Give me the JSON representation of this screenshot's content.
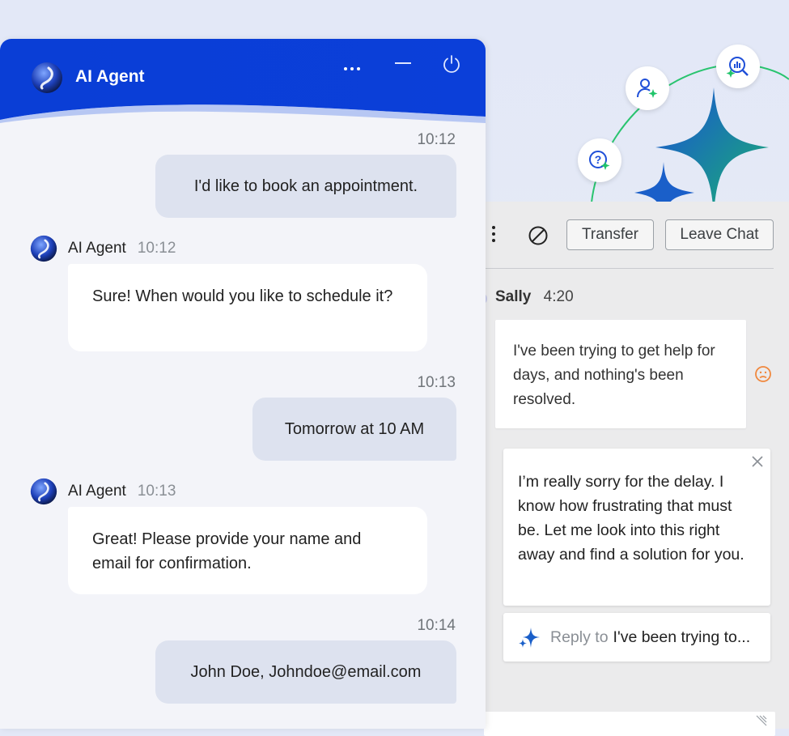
{
  "widget": {
    "title": "AI Agent",
    "messages": [
      {
        "type": "user",
        "time": "10:12",
        "text": "I'd like to book an appointment."
      },
      {
        "type": "agent",
        "name": "AI Agent",
        "time": "10:12",
        "text": "Sure! When would you like to schedule it?"
      },
      {
        "type": "user",
        "time": "10:13",
        "text": "Tomorrow at 10 AM"
      },
      {
        "type": "agent",
        "name": "AI Agent",
        "time": "10:13",
        "text": "Great! Please provide your name and email for confirmation."
      },
      {
        "type": "user",
        "time": "10:14",
        "text": "John Doe, Johndoe@email.com"
      }
    ]
  },
  "console": {
    "transfer_label": "Transfer",
    "leave_label": "Leave Chat",
    "customer": {
      "name": "Sally",
      "time": "4:20",
      "text": "I've been trying to get help for days, and nothing's been resolved."
    },
    "suggestion": "I’m really sorry for the delay. I know how frustrating that must be. Let me look into this right away and find a solution for you.",
    "reply_prefix": "Reply to",
    "reply_target": "I've been trying to..."
  },
  "colors": {
    "header_blue": "#0a3ed6",
    "user_bubble": "#dde2ef",
    "accent_green": "#1fc46a",
    "sentiment_orange": "#f0883e"
  }
}
